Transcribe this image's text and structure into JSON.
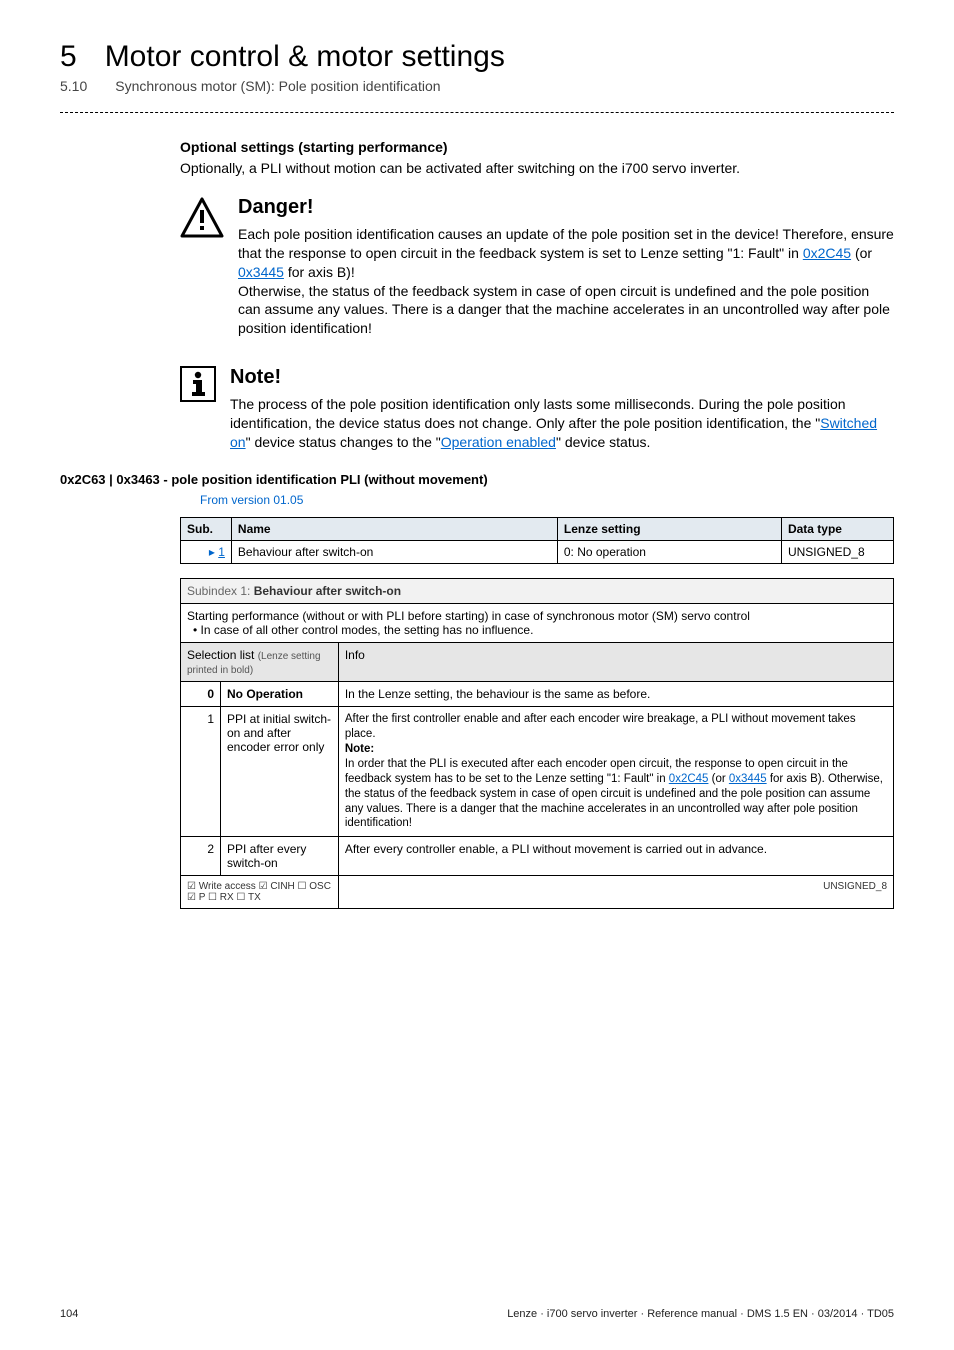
{
  "chapter": {
    "num": "5",
    "title": "Motor control & motor settings"
  },
  "section": {
    "num": "5.10",
    "title": "Synchronous motor (SM): Pole position identification"
  },
  "opt": {
    "head": "Optional settings (starting performance)",
    "para": "Optionally, a PLI without motion can be activated after switching on the i700 servo inverter."
  },
  "danger": {
    "title": "Danger!",
    "p1a": "Each pole position identification causes an update of the pole position set in the device! Therefore, ensure that the response to open circuit in the feedback system is set to Lenze setting \"1: Fault\" in ",
    "link1": "0x2C45",
    "mid1": " (or ",
    "link2": "0x3445",
    "p1b": " for axis B)!",
    "p2": "Otherwise, the status of the feedback system in case of open circuit is undefined and the pole position can assume any values. There is a danger that the machine accelerates in an uncontrolled way after pole position identification!"
  },
  "note": {
    "title": "Note!",
    "p1a": "The process of the pole position identification only lasts some milliseconds. During the pole position identification, the device status does not change. Only after the pole position identification, the \"",
    "link1": "Switched on",
    "mid1": "\" device status changes to the \"",
    "link2": "Operation enabled",
    "p1b": "\" device status."
  },
  "obj": {
    "head": "0x2C63 | 0x3463 - pole position identification PLI (without movement)",
    "version": "From version 01.05"
  },
  "t1": {
    "h_sub": "Sub.",
    "h_name": "Name",
    "h_lenze": "Lenze setting",
    "h_dt": "Data type",
    "r1_arrow": "▸",
    "r1_sub": "1",
    "r1_name": "Behaviour after switch-on",
    "r1_lenze": "0: No operation",
    "r1_dt": "UNSIGNED_8"
  },
  "t2": {
    "sub_lead": "Subindex 1: ",
    "sub_bold": "Behaviour after switch-on",
    "desc": "Starting performance (without or with PLI before starting) in case of synchronous motor (SM) servo control",
    "desc_bullet": "• In case of all other control modes, the setting has no influence.",
    "sel_label": "Selection list ",
    "sel_tiny": "(Lenze setting printed in bold)",
    "info_label": "Info",
    "r0_num": "0",
    "r0_name": "No Operation",
    "r0_info": "In the Lenze setting, the behaviour is the same as before.",
    "r1_num": "1",
    "r1_name": "PPI at initial switch-on and after encoder error only",
    "r1_info1": "After the first controller enable and after each encoder wire breakage, a PLI without movement takes place.",
    "r1_note": "Note:",
    "r1_info2a": "In order that the PLI is executed after each encoder open circuit, the response to open circuit in the feedback system has to be set to the Lenze setting \"1: Fault\" in ",
    "r1_link1": "0x2C45",
    "r1_mid1": " (or ",
    "r1_link2": "0x3445",
    "r1_info2b": " for axis B). Otherwise, the status of the feedback system in case of open circuit is undefined and the pole position can assume any values. There is a danger that the machine accelerates in an uncontrolled way after pole position identification!",
    "r2_num": "2",
    "r2_name": "PPI after every switch-on",
    "r2_info": "After every controller enable, a PLI without movement is carried out in advance.",
    "write": "☑ Write access   ☑ CINH   ☐ OSC   ☑ P   ☐ RX   ☐ TX",
    "write_dt": "UNSIGNED_8"
  },
  "footer": {
    "page": "104",
    "meta": "Lenze · i700 servo inverter · Reference manual · DMS 1.5 EN · 03/2014 · TD05"
  }
}
